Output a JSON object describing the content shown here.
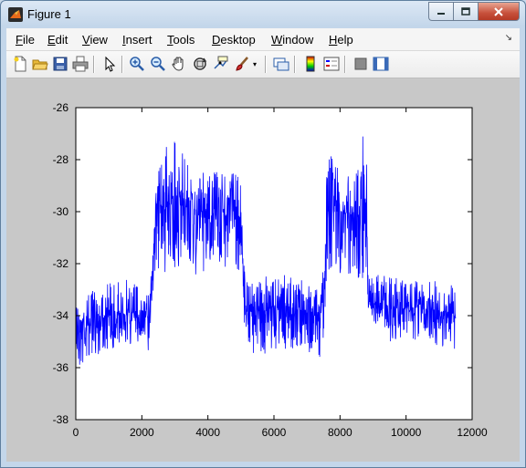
{
  "window": {
    "title": "Figure 1"
  },
  "menu": [
    {
      "u": "F",
      "rest": "ile"
    },
    {
      "u": "E",
      "rest": "dit"
    },
    {
      "u": "V",
      "rest": "iew"
    },
    {
      "u": "I",
      "rest": "nsert"
    },
    {
      "u": "T",
      "rest": "ools"
    },
    {
      "u": "D",
      "rest": "esktop"
    },
    {
      "u": "W",
      "rest": "indow"
    },
    {
      "u": "H",
      "rest": "elp"
    }
  ],
  "toolbar_icons": [
    "new-figure-icon",
    "open-file-icon",
    "save-icon",
    "print-icon",
    "edit-plot-arrow-icon",
    "zoom-in-icon",
    "zoom-out-icon",
    "pan-hand-icon",
    "rotate-3d-icon",
    "data-cursor-icon",
    "brush-icon",
    "link-plot-icon",
    "colorbar-icon",
    "legend-icon",
    "hide-plot-tools-icon",
    "show-plot-tools-icon"
  ],
  "colors": {
    "line": "#0000ff",
    "axes_bg": "#ffffff",
    "figure_bg": "#c8c8c8"
  },
  "chart_data": {
    "type": "line",
    "title": "",
    "xlabel": "",
    "ylabel": "",
    "xlim": [
      0,
      12000
    ],
    "ylim": [
      -38,
      -26
    ],
    "x_ticks": [
      "0",
      "2000",
      "4000",
      "6000",
      "8000",
      "10000",
      "12000"
    ],
    "y_ticks": [
      "-26",
      "-28",
      "-30",
      "-32",
      "-34",
      "-36",
      "-38"
    ],
    "grid": false,
    "series": [
      {
        "color": "#0000ff",
        "envelope_x": [
          0,
          500,
          1000,
          1500,
          2000,
          2200,
          2300,
          2400,
          2600,
          3000,
          3500,
          4000,
          4500,
          5000,
          5100,
          5200,
          5400,
          5800,
          6200,
          6600,
          7000,
          7400,
          7500,
          7600,
          7800,
          8200,
          8600,
          8800,
          8850,
          9000,
          9500,
          10000,
          10500,
          11000,
          11500
        ],
        "envelope_lo": [
          -36.3,
          -35.6,
          -35.3,
          -35.2,
          -35.0,
          -35.9,
          -33.5,
          -32.5,
          -32.3,
          -32.4,
          -32.6,
          -32.4,
          -32.2,
          -32.3,
          -34.5,
          -35.0,
          -35.5,
          -35.5,
          -35.3,
          -35.3,
          -35.4,
          -35.7,
          -35.3,
          -32.6,
          -32.4,
          -32.5,
          -32.8,
          -32.5,
          -34.2,
          -34.5,
          -35.0,
          -35.0,
          -35.0,
          -35.2,
          -35.3
        ],
        "envelope_hi": [
          -33.3,
          -33.0,
          -32.6,
          -32.5,
          -32.7,
          -33.0,
          -31.3,
          -28.4,
          -27.6,
          -27.2,
          -28.2,
          -28.5,
          -28.4,
          -28.2,
          -32.2,
          -32.5,
          -32.8,
          -32.4,
          -32.3,
          -32.5,
          -32.6,
          -33.0,
          -31.7,
          -27.0,
          -27.8,
          -28.4,
          -27.8,
          -26.2,
          -32.0,
          -32.4,
          -32.5,
          -32.6,
          -32.7,
          -32.5,
          -32.8
        ],
        "center_y": [
          -34.4,
          -34.2,
          -34.0,
          -33.9,
          -33.9,
          -34.2,
          -32.5,
          -30.0,
          -29.8,
          -29.7,
          -29.9,
          -30.0,
          -30.0,
          -30.0,
          -33.5,
          -33.7,
          -34.0,
          -33.8,
          -33.7,
          -33.8,
          -33.8,
          -34.1,
          -33.6,
          -30.0,
          -29.9,
          -30.1,
          -30.1,
          -29.8,
          -33.4,
          -33.6,
          -33.7,
          -33.7,
          -33.7,
          -33.8,
          -33.9
        ]
      }
    ]
  }
}
